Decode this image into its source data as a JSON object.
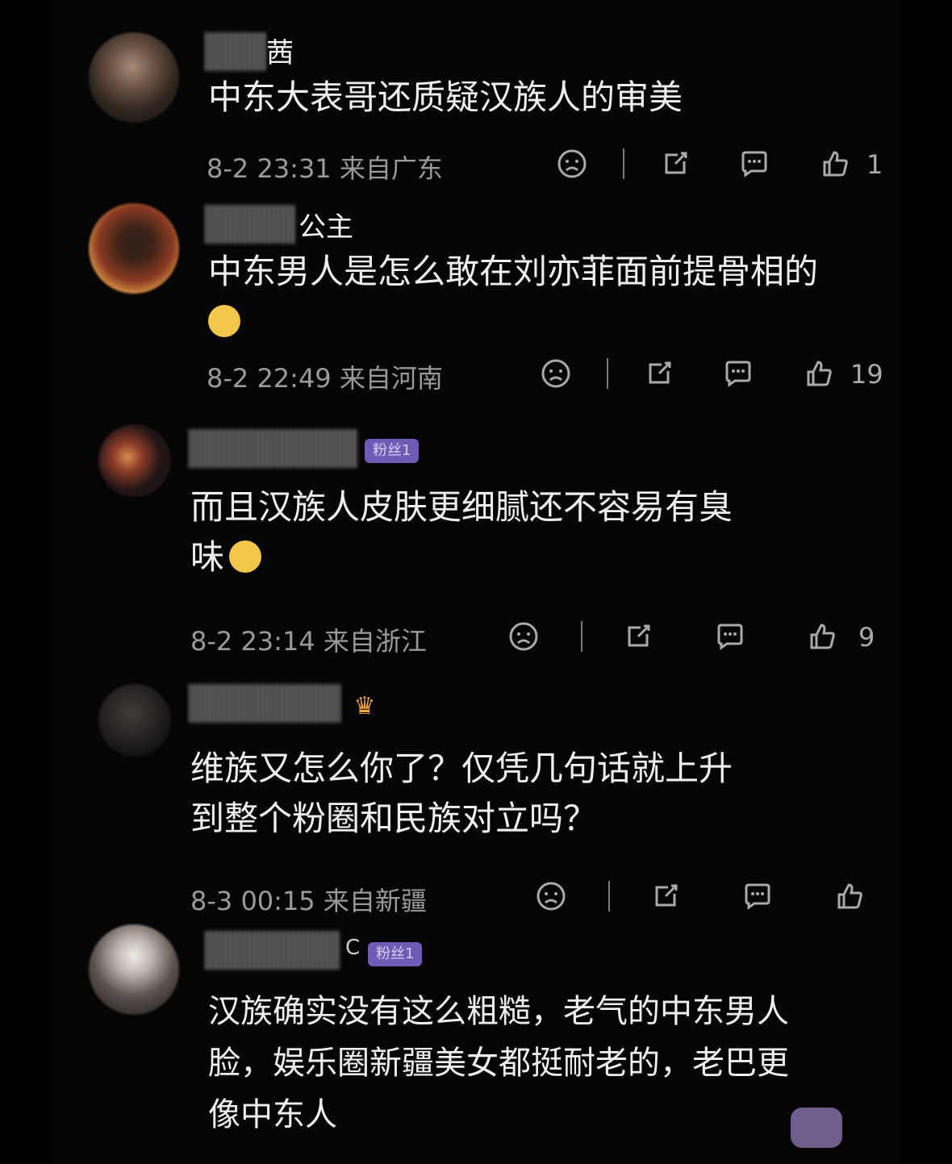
{
  "comments": [
    {
      "name_suffix": "茜",
      "text_lines": [
        "中东大表哥还质疑汉族人的审美"
      ],
      "meta": "8-2 23:31  来自广东",
      "likes": "1"
    },
    {
      "name_suffix": "公主",
      "text_lines": [
        "中东男人是怎么敢在刘亦菲面前提骨相的"
      ],
      "meta": "8-2 22:49  来自河南",
      "likes": "19"
    },
    {
      "badge": "粉丝1",
      "text_lines": [
        "而且汉族人皮肤更细腻还不容易有臭",
        "味"
      ],
      "meta": "8-2 23:14  来自浙江",
      "likes": "9"
    },
    {
      "text_lines": [
        "维族又怎么你了？仅凭几句话就上升",
        "到整个粉圈和民族对立吗？"
      ],
      "meta": "8-3 00:15  来自新疆",
      "likes": ""
    },
    {
      "name_suffix": "C",
      "badge": "粉丝1",
      "text_lines": [
        "汉族确实没有这么粗糙，老气的中东男人",
        "脸，娱乐圈新疆美女都挺耐老的，老巴更",
        "像中东人"
      ]
    }
  ]
}
